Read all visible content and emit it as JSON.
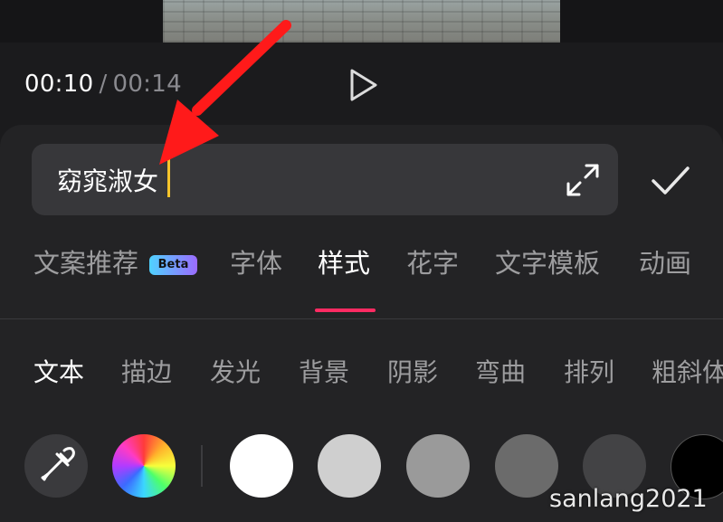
{
  "video": {
    "current_time": "00:10",
    "separator": "/",
    "total_time": "00:14"
  },
  "editor": {
    "input_text": "窈窕淑女"
  },
  "tabs": [
    {
      "label": "文案推荐",
      "badge": "Beta"
    },
    {
      "label": "字体"
    },
    {
      "label": "样式",
      "active": true
    },
    {
      "label": "花字"
    },
    {
      "label": "文字模板"
    },
    {
      "label": "动画"
    }
  ],
  "style_tabs": [
    {
      "label": "文本",
      "active": true
    },
    {
      "label": "描边"
    },
    {
      "label": "发光"
    },
    {
      "label": "背景"
    },
    {
      "label": "阴影"
    },
    {
      "label": "弯曲"
    },
    {
      "label": "排列"
    },
    {
      "label": "粗斜体"
    }
  ],
  "colors": [
    "#ffffff",
    "#cfcfcf",
    "#9a9a9a",
    "#6b6b6b",
    "#434345",
    "#000000"
  ],
  "accent_color": "#ff2b62",
  "caret_color": "#f6c42b",
  "annotation_arrow_color": "#ff1a1a",
  "watermark": "sanlang2021"
}
